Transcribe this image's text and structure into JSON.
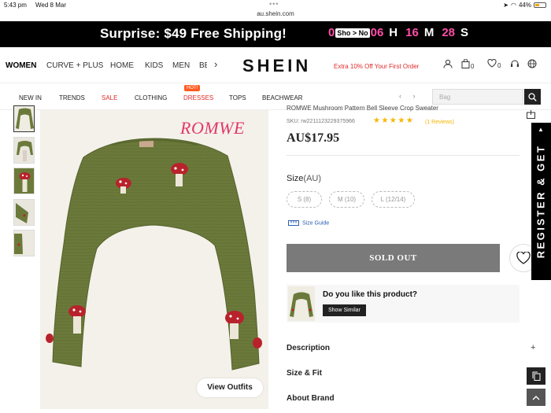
{
  "status": {
    "time": "5:43 pm",
    "date": "Wed 8 Mar",
    "battery": "44%",
    "battery_level": 0.44,
    "dots": "•••"
  },
  "browser": {
    "url": "au.shein.com"
  },
  "promo": {
    "text": "Surprise: $49 Free Shipping!",
    "box_text": "Sho > No",
    "digit_a": "0",
    "digit_b": "06",
    "hours_unit": "H",
    "minutes": "16",
    "minutes_unit": "M",
    "seconds": "28",
    "seconds_unit": "S"
  },
  "nav": {
    "categories": [
      "WOMEN",
      "CURVE + PLUS",
      "HOME",
      "KIDS",
      "MEN",
      "BE"
    ],
    "more_icon": "›",
    "logo": "SHEIN",
    "offer": "Extra 10% Off Your First Order",
    "bag_count": "0",
    "wish_count": "0"
  },
  "subnav": {
    "items": [
      "NEW IN",
      "TRENDS",
      "SALE",
      "CLOTHING",
      "DRESSES",
      "TOPS",
      "BEACHWEAR"
    ],
    "hot_badge": "HOT!",
    "arrows": "‹ ›",
    "search_placeholder": "Bag"
  },
  "product": {
    "brand": "ROMWE",
    "title": "ROMWE Mushroom Pattern Bell Sleeve Crop Sweater",
    "sku": "SKU: rw2211123229375966",
    "stars": "★★★★★",
    "rating": 5,
    "reviews": "(1 Reviews)",
    "price": "AU$17.95",
    "size_label": "Size",
    "size_unit": "(AU)",
    "sizes": [
      "S (8)",
      "M (10)",
      "L (12/14)"
    ],
    "size_guide": "Size Guide",
    "sold_out": "SOLD OUT",
    "view_outfits": "View Outfits",
    "like_question": "Do you like this product?",
    "show_similar": "Show Similar",
    "sections": [
      "Description",
      "Size & Fit",
      "About Brand"
    ],
    "expand": "+"
  },
  "register_tab": "REGISTER & GET",
  "colors": {
    "accent_pink": "#ff4fa8",
    "brand_red": "#e2386a",
    "sweater_green": "#6b7a3a",
    "star": "#f7b500"
  }
}
